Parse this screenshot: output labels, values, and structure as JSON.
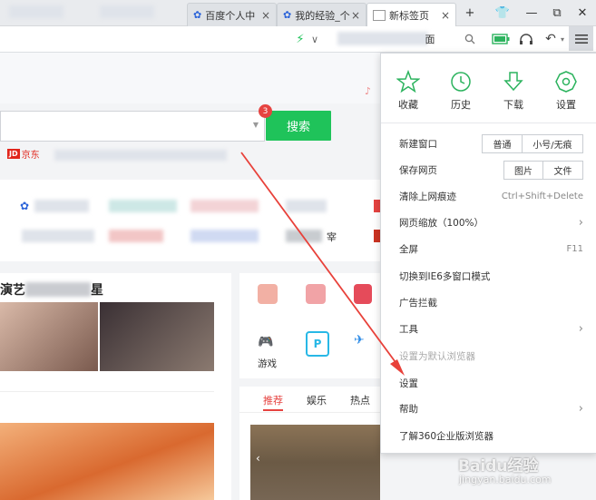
{
  "tabs": [
    {
      "label": "百度个人中",
      "close": "×"
    },
    {
      "label": "我的经验_个",
      "close": "×"
    },
    {
      "label": "新标签页",
      "close": "×"
    }
  ],
  "tabbar": {
    "new_tab": "+",
    "skin": "👕",
    "minimize": "—",
    "restore": "⧉",
    "close": "✕"
  },
  "addressbar": {
    "url_tail": "面",
    "dropdown": "∨"
  },
  "search": {
    "button": "搜索",
    "badge": "3"
  },
  "jd": {
    "logo": "JD",
    "label": "京东"
  },
  "content": {
    "news_title_left": "演艺",
    "news_title_right": "星",
    "apps": [
      "游戏"
    ],
    "news_tabs": [
      {
        "label": "推荐",
        "active": true
      },
      {
        "label": "娱乐",
        "active": false
      },
      {
        "label": "热点",
        "active": false
      }
    ],
    "quick_item": "宰",
    "watermark": "Baidu经验",
    "watermark_url": "jingyan.baidu.com"
  },
  "menu": {
    "quick_actions": [
      {
        "label": "收藏",
        "icon": "star-icon"
      },
      {
        "label": "历史",
        "icon": "clock-icon"
      },
      {
        "label": "下载",
        "icon": "download-icon"
      },
      {
        "label": "设置",
        "icon": "gear-icon"
      }
    ],
    "items": [
      {
        "label": "新建窗口",
        "buttons": [
          "普通",
          "小号/无痕"
        ]
      },
      {
        "label": "保存网页",
        "buttons": [
          "图片",
          "文件"
        ]
      },
      {
        "label": "清除上网痕迹",
        "shortcut": "Ctrl+Shift+Delete"
      },
      {
        "label": "网页缩放（100%）",
        "arrow": "›"
      },
      {
        "label": "全屏",
        "shortcut": "F11"
      },
      {
        "label": "切换到IE6多窗口模式"
      },
      {
        "label": "广告拦截"
      },
      {
        "label": "工具",
        "arrow": "›"
      },
      {
        "label": "设置为默认浏览器",
        "disabled": true
      },
      {
        "label": "设置"
      },
      {
        "label": "帮助",
        "arrow": "›"
      },
      {
        "label": "了解360企业版浏览器"
      }
    ]
  },
  "colors": {
    "accent_green": "#1fc35a",
    "icon_green": "#2cb35e",
    "badge_red": "#e64340",
    "arrow_red": "#e8413a"
  }
}
